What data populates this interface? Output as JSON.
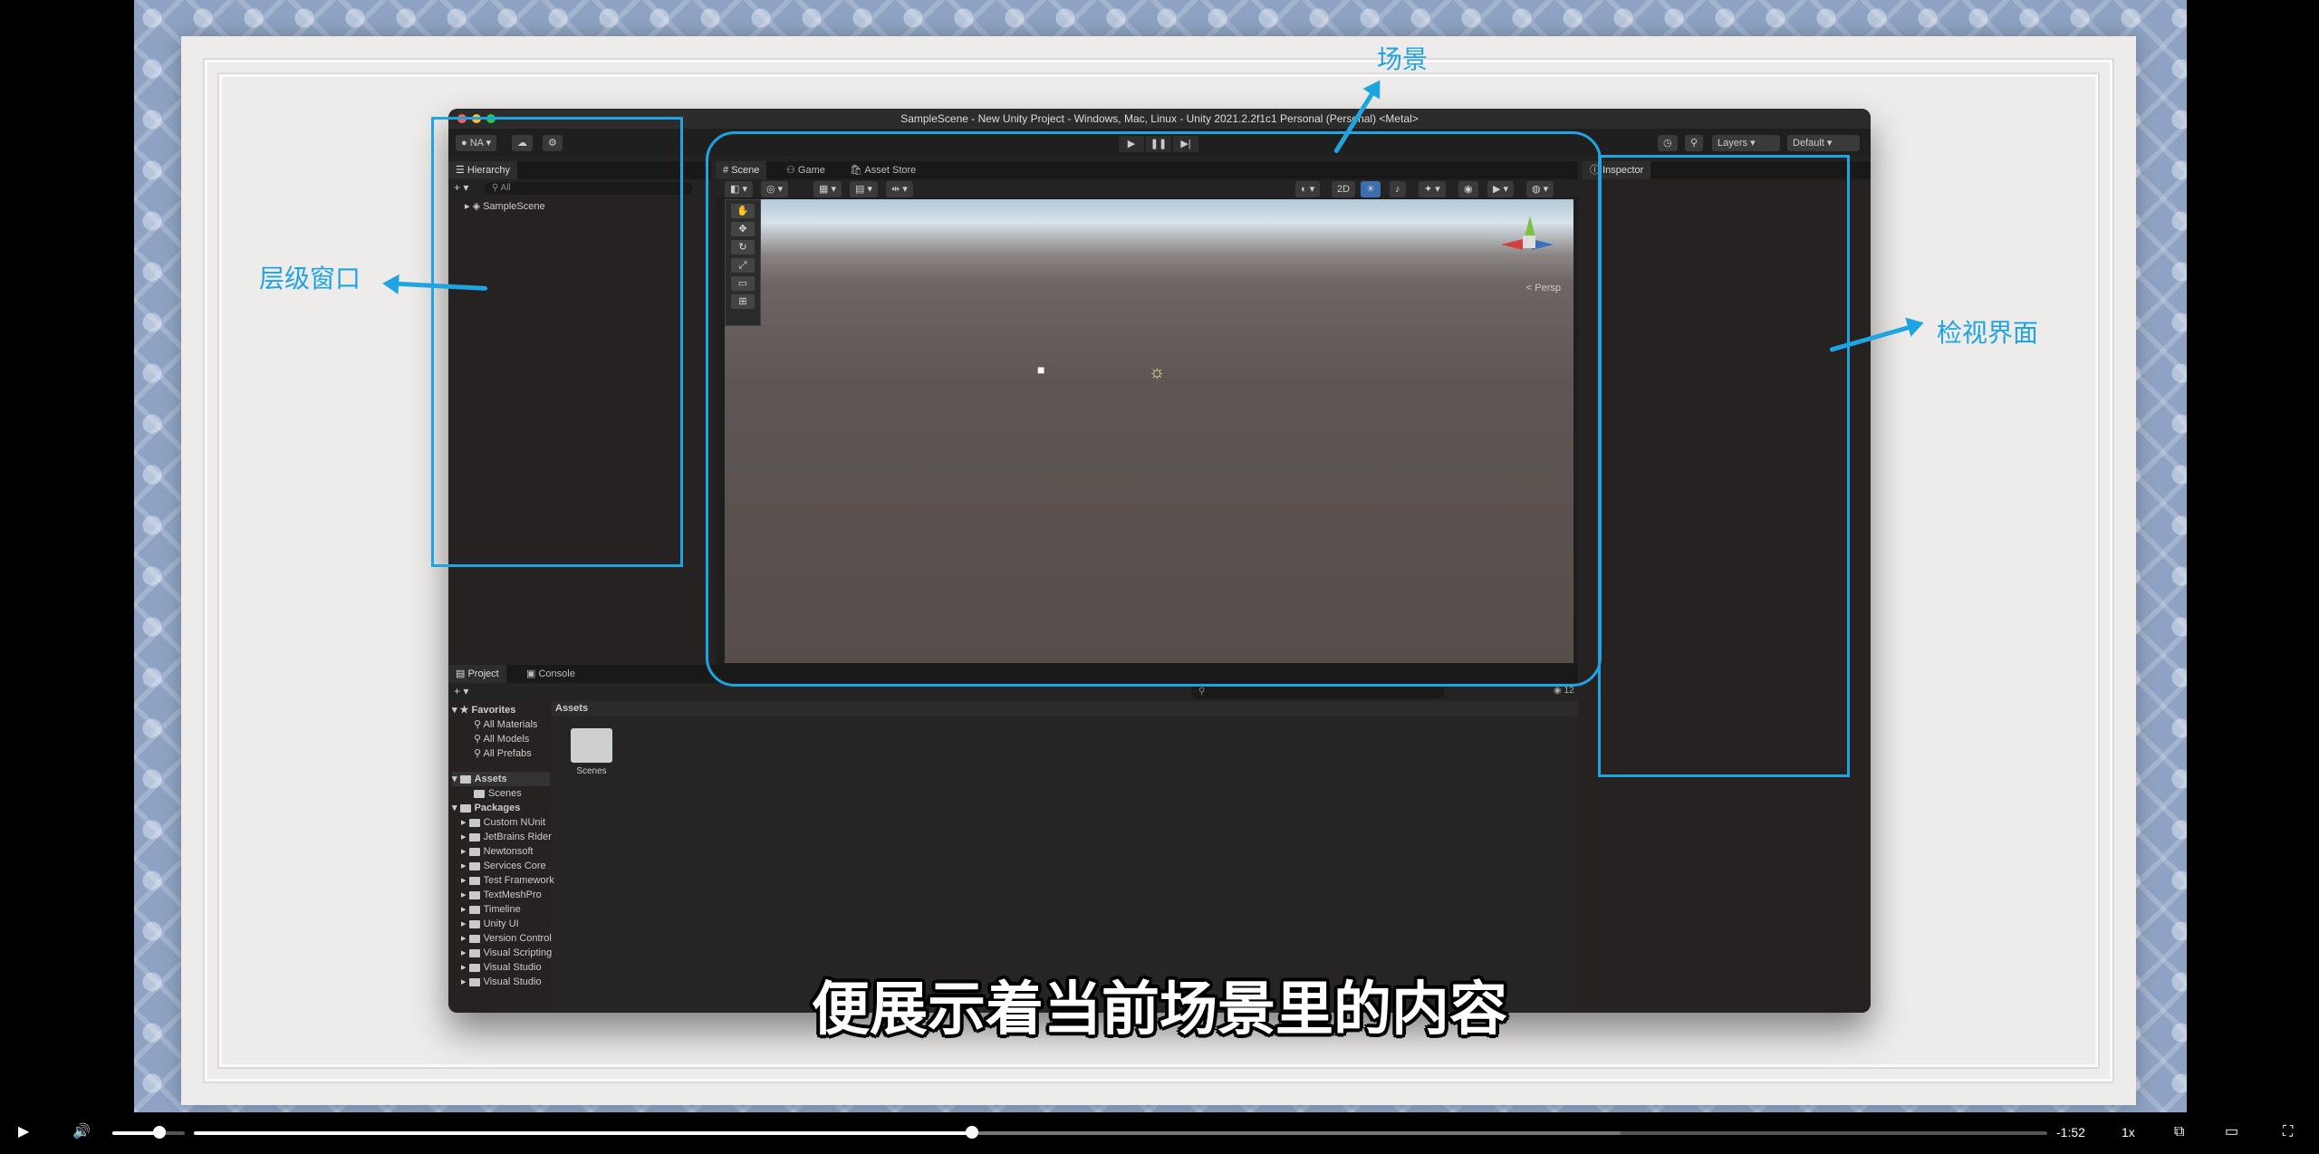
{
  "unity": {
    "title": "SampleScene - New Unity Project - Windows, Mac, Linux - Unity 2021.2.2f1c1 Personal (Personal) <Metal>",
    "account": "NA",
    "layers_label": "Layers",
    "layout_label": "Default",
    "hierarchy_tab": "Hierarchy",
    "hierarchy_search": "All",
    "scene_root": "SampleScene",
    "scene_tabs": [
      "Scene",
      "Game",
      "Asset Store"
    ],
    "view_mode_2d": "2D",
    "persp_label": "< Persp",
    "inspector_tab": "Inspector",
    "project_tabs": [
      "Project",
      "Console"
    ],
    "favorites_label": "Favorites",
    "favorites": [
      "All Materials",
      "All Models",
      "All Prefabs"
    ],
    "assets_label": "Assets",
    "assets_children": [
      "Scenes"
    ],
    "packages_label": "Packages",
    "packages": [
      "Custom NUnit",
      "JetBrains Rider",
      "Newtonsoft",
      "Services Core",
      "Test Framework",
      "TextMeshPro",
      "Timeline",
      "Unity UI",
      "Version Control",
      "Visual Scripting",
      "Visual Studio",
      "Visual Studio"
    ],
    "assets_header": "Assets",
    "asset_items": [
      "Scenes"
    ],
    "hidden_count": "12"
  },
  "annotations": {
    "scene_label": "场景",
    "hierarchy_label": "层级窗口",
    "inspector_label": "检视界面",
    "color": "#1ea4e1"
  },
  "subtitle": "便展示着当前场景里的内容",
  "player": {
    "time_remaining": "-1:52",
    "speed": "1x",
    "progress": 0.42,
    "buffered": 0.77,
    "volume": 0.65,
    "icons": [
      "play-icon",
      "volume-icon",
      "pip-icon",
      "theater-icon",
      "fullscreen-icon"
    ]
  }
}
